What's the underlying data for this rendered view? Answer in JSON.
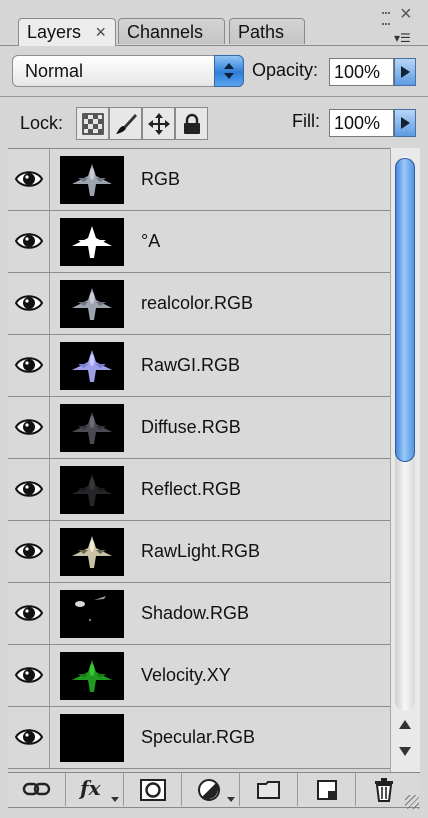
{
  "panel": {
    "tabs": [
      "Layers",
      "Channels",
      "Paths"
    ],
    "active_tab": "Layers",
    "tab_close_glyph": "×",
    "blend_mode": "Normal",
    "opacity_label": "Opacity:",
    "opacity_value": "100%",
    "lock_label": "Lock:",
    "lock_icons": [
      "lock-transparent-pixels-icon",
      "lock-image-pixels-icon",
      "lock-position-icon",
      "lock-all-icon"
    ],
    "fill_label": "Fill:",
    "fill_value": "100%",
    "accent_color": "#2f7ed8"
  },
  "layers": [
    {
      "name": "RGB",
      "visible": true,
      "thumb": "gray"
    },
    {
      "name": "°A",
      "visible": true,
      "thumb": "white-silhouette"
    },
    {
      "name": "realcolor.RGB",
      "visible": true,
      "thumb": "gray"
    },
    {
      "name": "RawGI.RGB",
      "visible": true,
      "thumb": "lavender"
    },
    {
      "name": "Diffuse.RGB",
      "visible": true,
      "thumb": "dark-gray"
    },
    {
      "name": "Reflect.RGB",
      "visible": true,
      "thumb": "very-dark"
    },
    {
      "name": "RawLight.RGB",
      "visible": true,
      "thumb": "warm-light"
    },
    {
      "name": "Shadow.RGB",
      "visible": true,
      "thumb": "sparse"
    },
    {
      "name": "Velocity.XY",
      "visible": true,
      "thumb": "green"
    },
    {
      "name": "Specular.RGB",
      "visible": true,
      "thumb": "black"
    }
  ],
  "scroll": {
    "position_fraction": 0.0,
    "visible_fraction": 0.55
  },
  "toolbar_icons": [
    "link-layers-icon",
    "layer-style-fx-icon",
    "layer-mask-icon",
    "adjustment-layer-icon",
    "new-group-folder-icon",
    "new-layer-icon",
    "trash-icon"
  ]
}
